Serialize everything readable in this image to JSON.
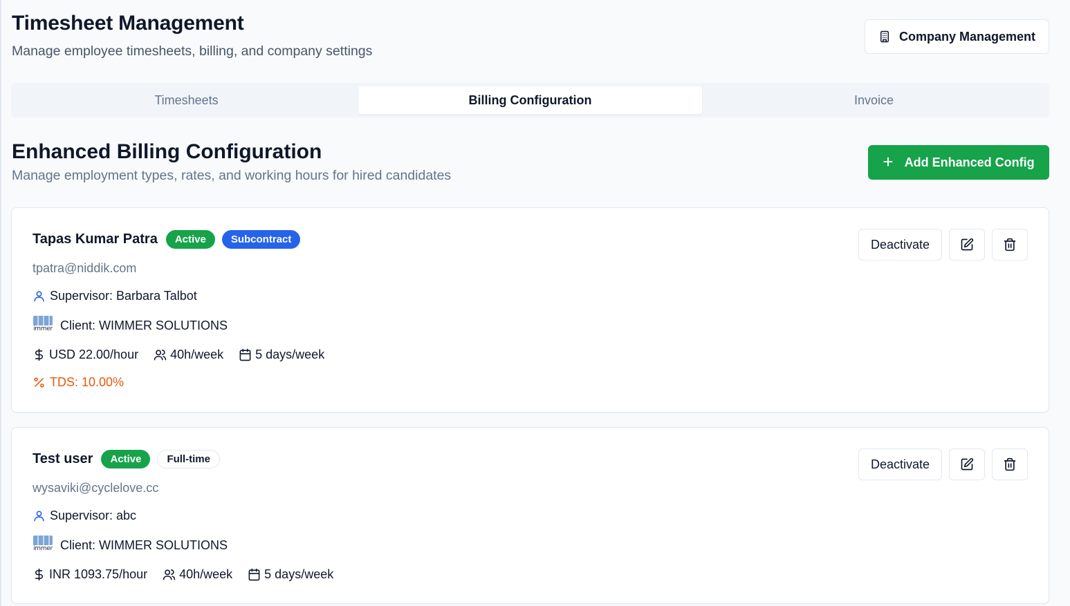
{
  "header": {
    "title": "Timesheet Management",
    "subtitle": "Manage employee timesheets, billing, and company settings",
    "company_button": "Company Management"
  },
  "tabs": [
    {
      "label": "Timesheets",
      "active": false
    },
    {
      "label": "Billing Configuration",
      "active": true
    },
    {
      "label": "Invoice",
      "active": false
    }
  ],
  "section": {
    "title": "Enhanced Billing Configuration",
    "subtitle": "Manage employment types, rates, and working hours for hired candidates",
    "add_button": "Add Enhanced Config",
    "add_icon": "+"
  },
  "configs": [
    {
      "name": "Tapas Kumar Patra",
      "status_badge": "Active",
      "type_badge": "Subcontract",
      "email": "tpatra@niddik.com",
      "supervisor": "Supervisor: Barbara Talbot",
      "client": "Client: WIMMER SOLUTIONS",
      "client_logo_text": "immer",
      "rate": "USD 22.00/hour",
      "hours": "40h/week",
      "days": "5 days/week",
      "tds": "TDS: 10.00%",
      "deactivate_label": "Deactivate"
    },
    {
      "name": "Test user",
      "status_badge": "Active",
      "type_badge": "Full-time",
      "email": "wysaviki@cyclelove.cc",
      "supervisor": "Supervisor: abc",
      "client": "Client: WIMMER SOLUTIONS",
      "client_logo_text": "immer",
      "rate": "INR 1093.75/hour",
      "hours": "40h/week",
      "days": "5 days/week",
      "deactivate_label": "Deactivate"
    }
  ],
  "colors": {
    "accent_green": "#16a34a",
    "badge_blue": "#2563eb",
    "tds_orange": "#ea580c",
    "supervisor_icon_blue": "#2563eb"
  },
  "icons": [
    "building-icon",
    "plus-icon",
    "user-icon",
    "client-logo",
    "dollar-icon",
    "users-icon",
    "calendar-icon",
    "percent-icon",
    "edit-icon",
    "trash-icon"
  ]
}
